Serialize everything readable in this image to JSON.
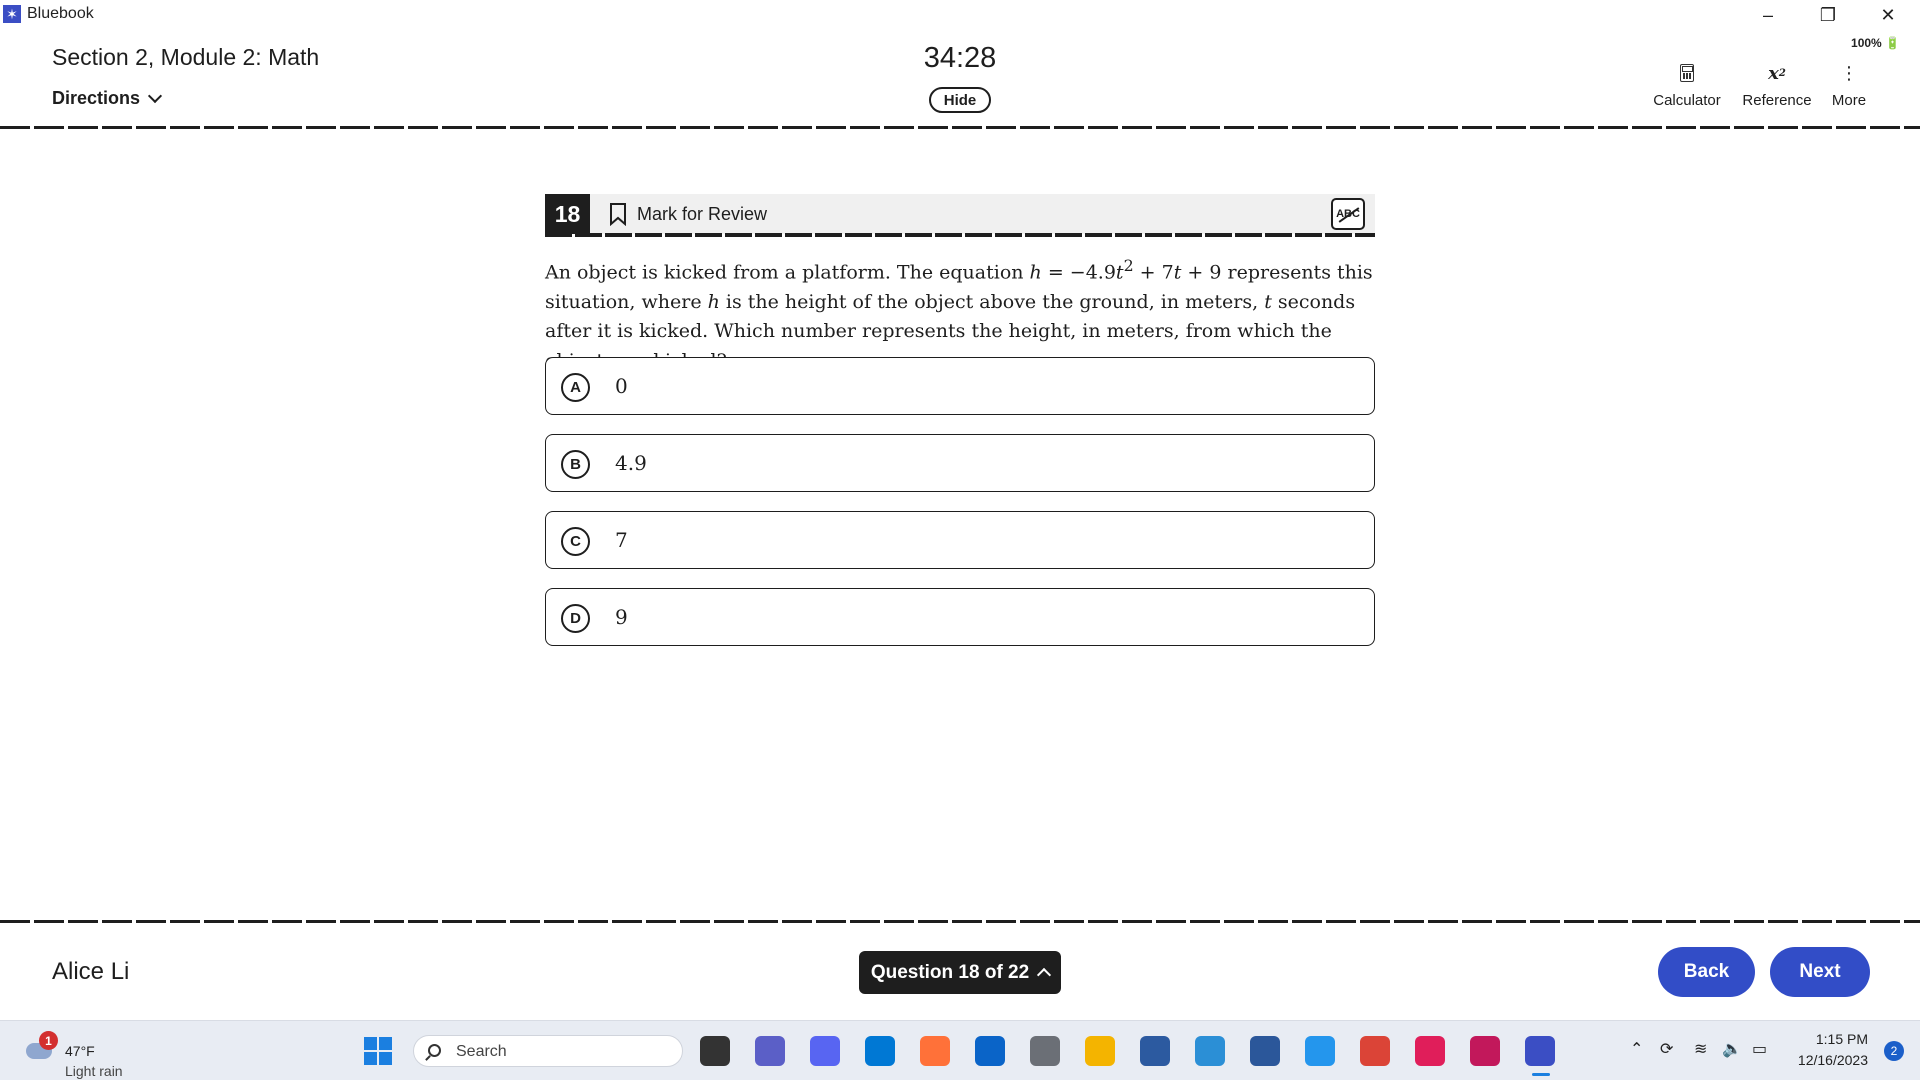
{
  "window": {
    "app_name": "Bluebook",
    "minimize_glyph": "–",
    "restore_glyph": "❐",
    "close_glyph": "✕",
    "battery_readout": "100% 🔋"
  },
  "header": {
    "section_title": "Section 2, Module 2: Math",
    "directions_label": "Directions",
    "timer": "34:28",
    "hide_label": "Hide",
    "tools": {
      "calculator_label": "Calculator",
      "reference_label": "Reference",
      "reference_glyph": "x",
      "reference_sup": "2",
      "more_label": "More",
      "more_glyph": "⋮"
    }
  },
  "question": {
    "number": "18",
    "mark_for_review_label": "Mark for Review",
    "eliminator_label": "ABC",
    "stem": {
      "p1": "An object is kicked from a platform. The equation ",
      "eq_h": "h",
      "eq_eq": " = −4.9",
      "eq_t1": "t",
      "eq_sup": "2",
      "eq_plus": " + 7",
      "eq_t2": "t",
      "eq_end": " + 9",
      "p2": " represents this situation, where ",
      "var_h": "h",
      "p3": " is the height of the object above the ground, in meters, ",
      "var_t": "t",
      "p4": " seconds after it is kicked. Which number represents the height, in meters, from which the object was kicked?"
    },
    "choices": [
      {
        "letter": "A",
        "text": "0"
      },
      {
        "letter": "B",
        "text": "4.9"
      },
      {
        "letter": "C",
        "text": "7"
      },
      {
        "letter": "D",
        "text": "9"
      }
    ]
  },
  "footer": {
    "student_name": "Alice Li",
    "question_nav_label": "Question 18 of 22",
    "back_label": "Back",
    "next_label": "Next"
  },
  "taskbar": {
    "weather_badge": "1",
    "weather_temp": "47°F",
    "weather_desc": "Light rain",
    "search_placeholder": "Search",
    "clock_time": "1:15 PM",
    "clock_date": "12/16/2023",
    "notification_count": "2",
    "apps": [
      {
        "name": "task-view-icon",
        "color": "#333333"
      },
      {
        "name": "teams-icon",
        "color": "#5b5fc7"
      },
      {
        "name": "discord-icon",
        "color": "#5865f2"
      },
      {
        "name": "vscode-icon",
        "color": "#0078d4"
      },
      {
        "name": "firefox-icon",
        "color": "#ff7139"
      },
      {
        "name": "outlook-icon",
        "color": "#0a64c8"
      },
      {
        "name": "calculator-app-icon",
        "color": "#6b6f76"
      },
      {
        "name": "file-explorer-icon",
        "color": "#f4b400"
      },
      {
        "name": "powershell-icon",
        "color": "#2c5aa0"
      },
      {
        "name": "edge-icon",
        "color": "#2b8fd6"
      },
      {
        "name": "word-icon",
        "color": "#2b579a"
      },
      {
        "name": "docker-icon",
        "color": "#2496ed"
      },
      {
        "name": "chrome-icon",
        "color": "#db4437"
      },
      {
        "name": "slack-icon",
        "color": "#e01e5a"
      },
      {
        "name": "snipping-tool-icon",
        "color": "#c2185b"
      },
      {
        "name": "bluebook-icon",
        "color": "#3b4ec4"
      }
    ]
  }
}
